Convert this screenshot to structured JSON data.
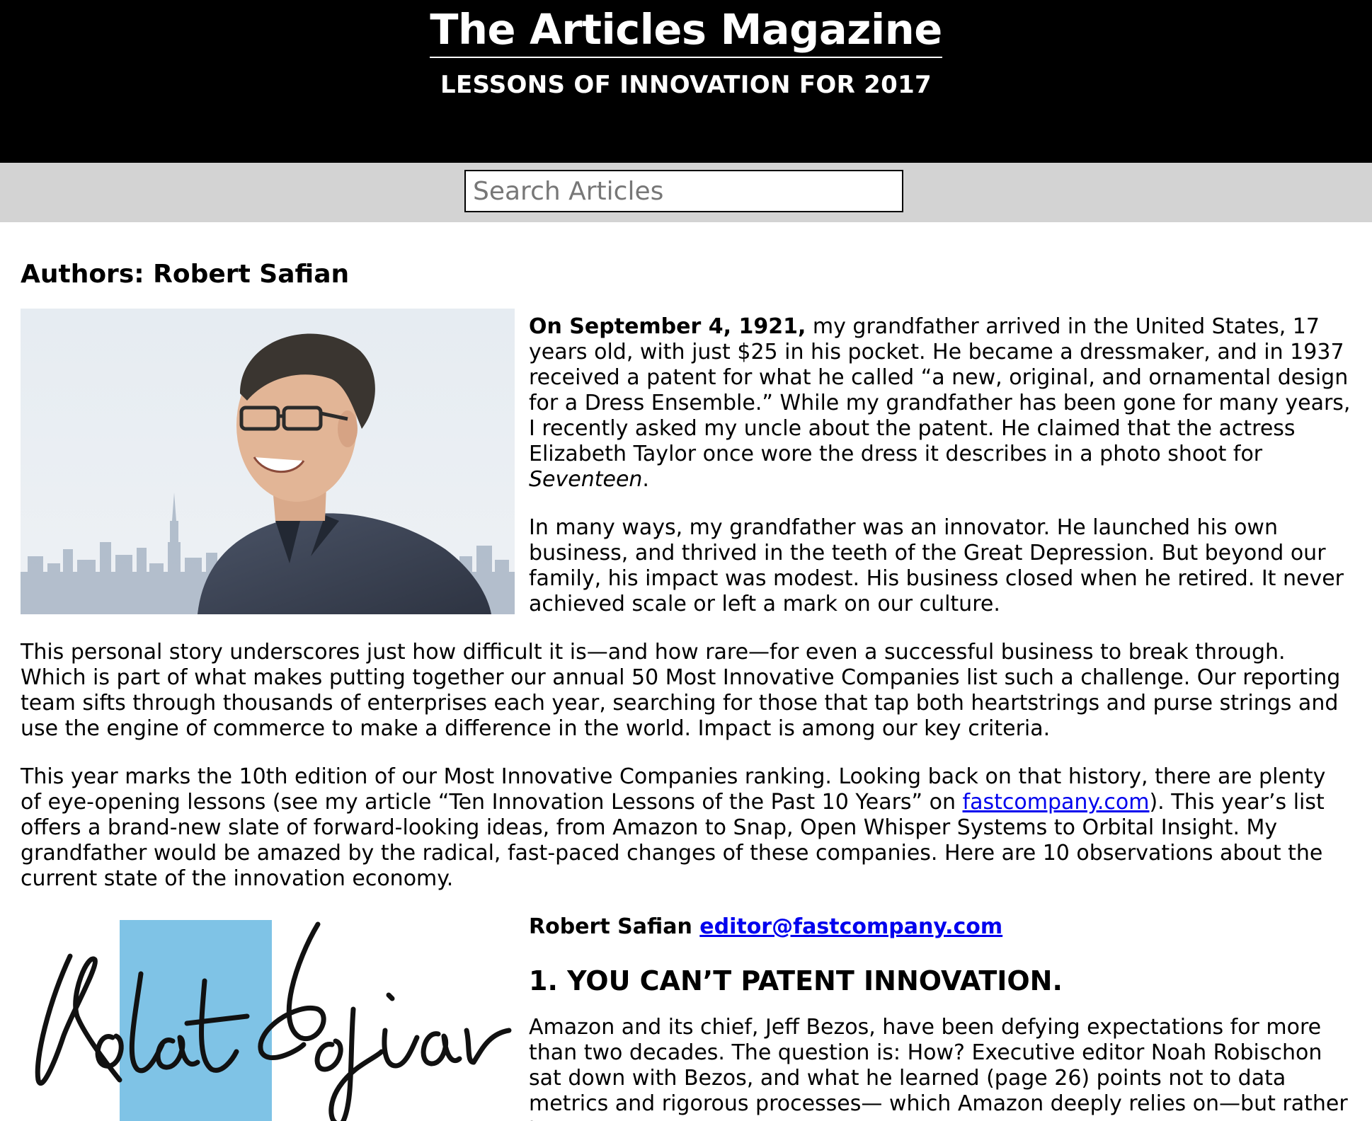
{
  "header": {
    "title": "The Articles Magazine",
    "subtitle": "LESSONS OF INNOVATION FOR 2017"
  },
  "search": {
    "placeholder": "Search Articles"
  },
  "article": {
    "authors": "Authors: Robert Safian",
    "p1_lead": "On September 4, 1921,",
    "p1_text": " my grandfather arrived in the United States, 17 years old, with just $25 in his pocket. He became a dressmaker, and in 1937 received a patent for what he called “a new, original, and ornamental design for a Dress Ensemble.” While my grandfather has been gone for many years, I recently asked my uncle about the patent. He claimed that the actress Elizabeth Taylor once wore the dress it describes in a photo shoot for ",
    "p1_italic": "Seventeen",
    "p1_end": ".",
    "p2": "In many ways, my grandfather was an innovator. He launched his own business, and thrived in the teeth of the Great Depression. But beyond our family, his impact was modest. His business closed when he retired. It never achieved scale or left a mark on our culture.",
    "p3": "This personal story underscores just how difficult it is—and how rare—for even a successful business to break through. Which is part of what makes putting together our annual 50 Most Innovative Companies list such a challenge. Our reporting team sifts through thousands of enterprises each year, searching for those that tap both heartstrings and purse strings and use the engine of commerce to make a difference in the world. Impact is among our key criteria.",
    "p4_a": "This year marks the 10th edition of our Most Innovative Companies ranking. Looking back on that history, there are plenty of eye-opening lessons (see my article “Ten Innovation Lessons of the Past 10 Years” on ",
    "p4_link": "fastcompany.com",
    "p4_b": "). This year’s list offers a brand-new slate of forward-looking ideas, from Amazon to Snap, Open Whisper Systems to Orbital Insight. My grandfather would be amazed by the radical, fast-paced changes of these companies. Here are 10 observations about the current state of the innovation economy.",
    "contact_name": "Robert Safian ",
    "contact_email": "editor@fastcompany.com",
    "heading1": "1. YOU CAN’T PATENT INNOVATION.",
    "p5": "Amazon and its chief, Jeff Bezos, have been defying expectations for more than two decades. The question is: How? Executive editor Noah Robischon sat down with Bezos, and what he learned (page 26) points not to data metrics and rigorous processes— which Amazon deeply relies on—but rather to a"
  },
  "colors": {
    "header_bg": "#000000",
    "search_bar_bg": "#d3d3d3",
    "link": "#0000ee",
    "signature_block": "#7fc3e6"
  }
}
